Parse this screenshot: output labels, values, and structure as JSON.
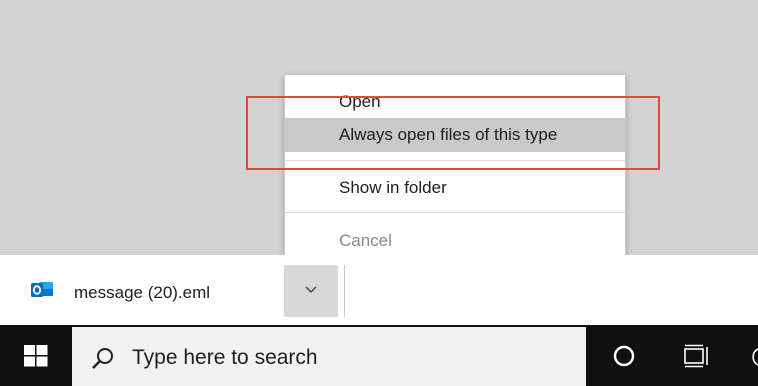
{
  "context_menu": {
    "items": [
      {
        "label": "Open",
        "state": "normal"
      },
      {
        "label": "Always open files of this type",
        "state": "highlighted"
      },
      {
        "label": "Show in folder",
        "state": "normal"
      },
      {
        "label": "Cancel",
        "state": "disabled"
      }
    ]
  },
  "download_shelf": {
    "file_name": "message (20).eml",
    "file_icon": "outlook-icon",
    "menu_button_icon": "chevron-down-icon"
  },
  "taskbar": {
    "search_placeholder": "Type here to search",
    "start_icon": "windows-logo-icon",
    "search_icon": "search-icon",
    "cortana_icon": "cortana-icon",
    "taskview_icon": "task-view-icon"
  },
  "colors": {
    "annotation": "#e0483e",
    "highlight": "#c9c9c9",
    "outlook_blue": "#0f6cbd",
    "taskbar": "#101010"
  }
}
